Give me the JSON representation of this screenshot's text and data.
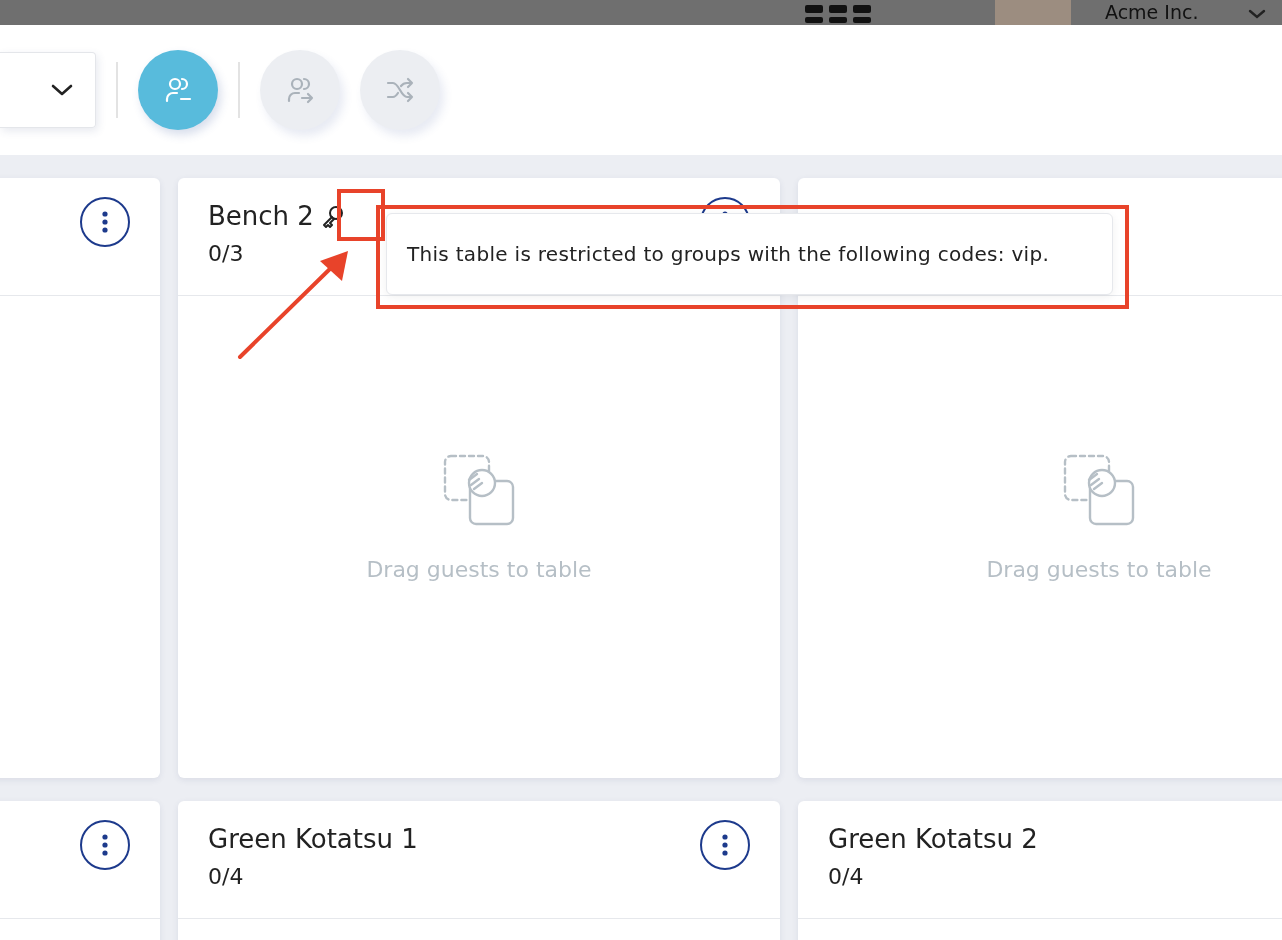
{
  "top_bar": {
    "account_name": "Acme Inc."
  },
  "toolbar": {
    "buttons": [
      {
        "kind": "unassign",
        "active": true
      },
      {
        "kind": "move",
        "active": false
      },
      {
        "kind": "shuffle",
        "active": false
      }
    ]
  },
  "table_rows": [
    {
      "cards": [
        {
          "restricted": false,
          "menu": true
        },
        {
          "title": "Bench 2",
          "count": "0/3",
          "restricted": true,
          "menu": true,
          "empty_text": "Drag guests to table"
        },
        {
          "restricted": false,
          "empty_text": "Drag guests to table"
        }
      ]
    },
    {
      "cards": [
        {
          "restricted": false,
          "menu": true
        },
        {
          "title": "Green Kotatsu 1",
          "count": "0/4",
          "restricted": false,
          "menu": true
        },
        {
          "title": "Green Kotatsu 2",
          "count": "0/4",
          "restricted": false
        }
      ]
    }
  ],
  "tooltip": {
    "text": "This table is restricted to groups with the following codes: vip."
  }
}
